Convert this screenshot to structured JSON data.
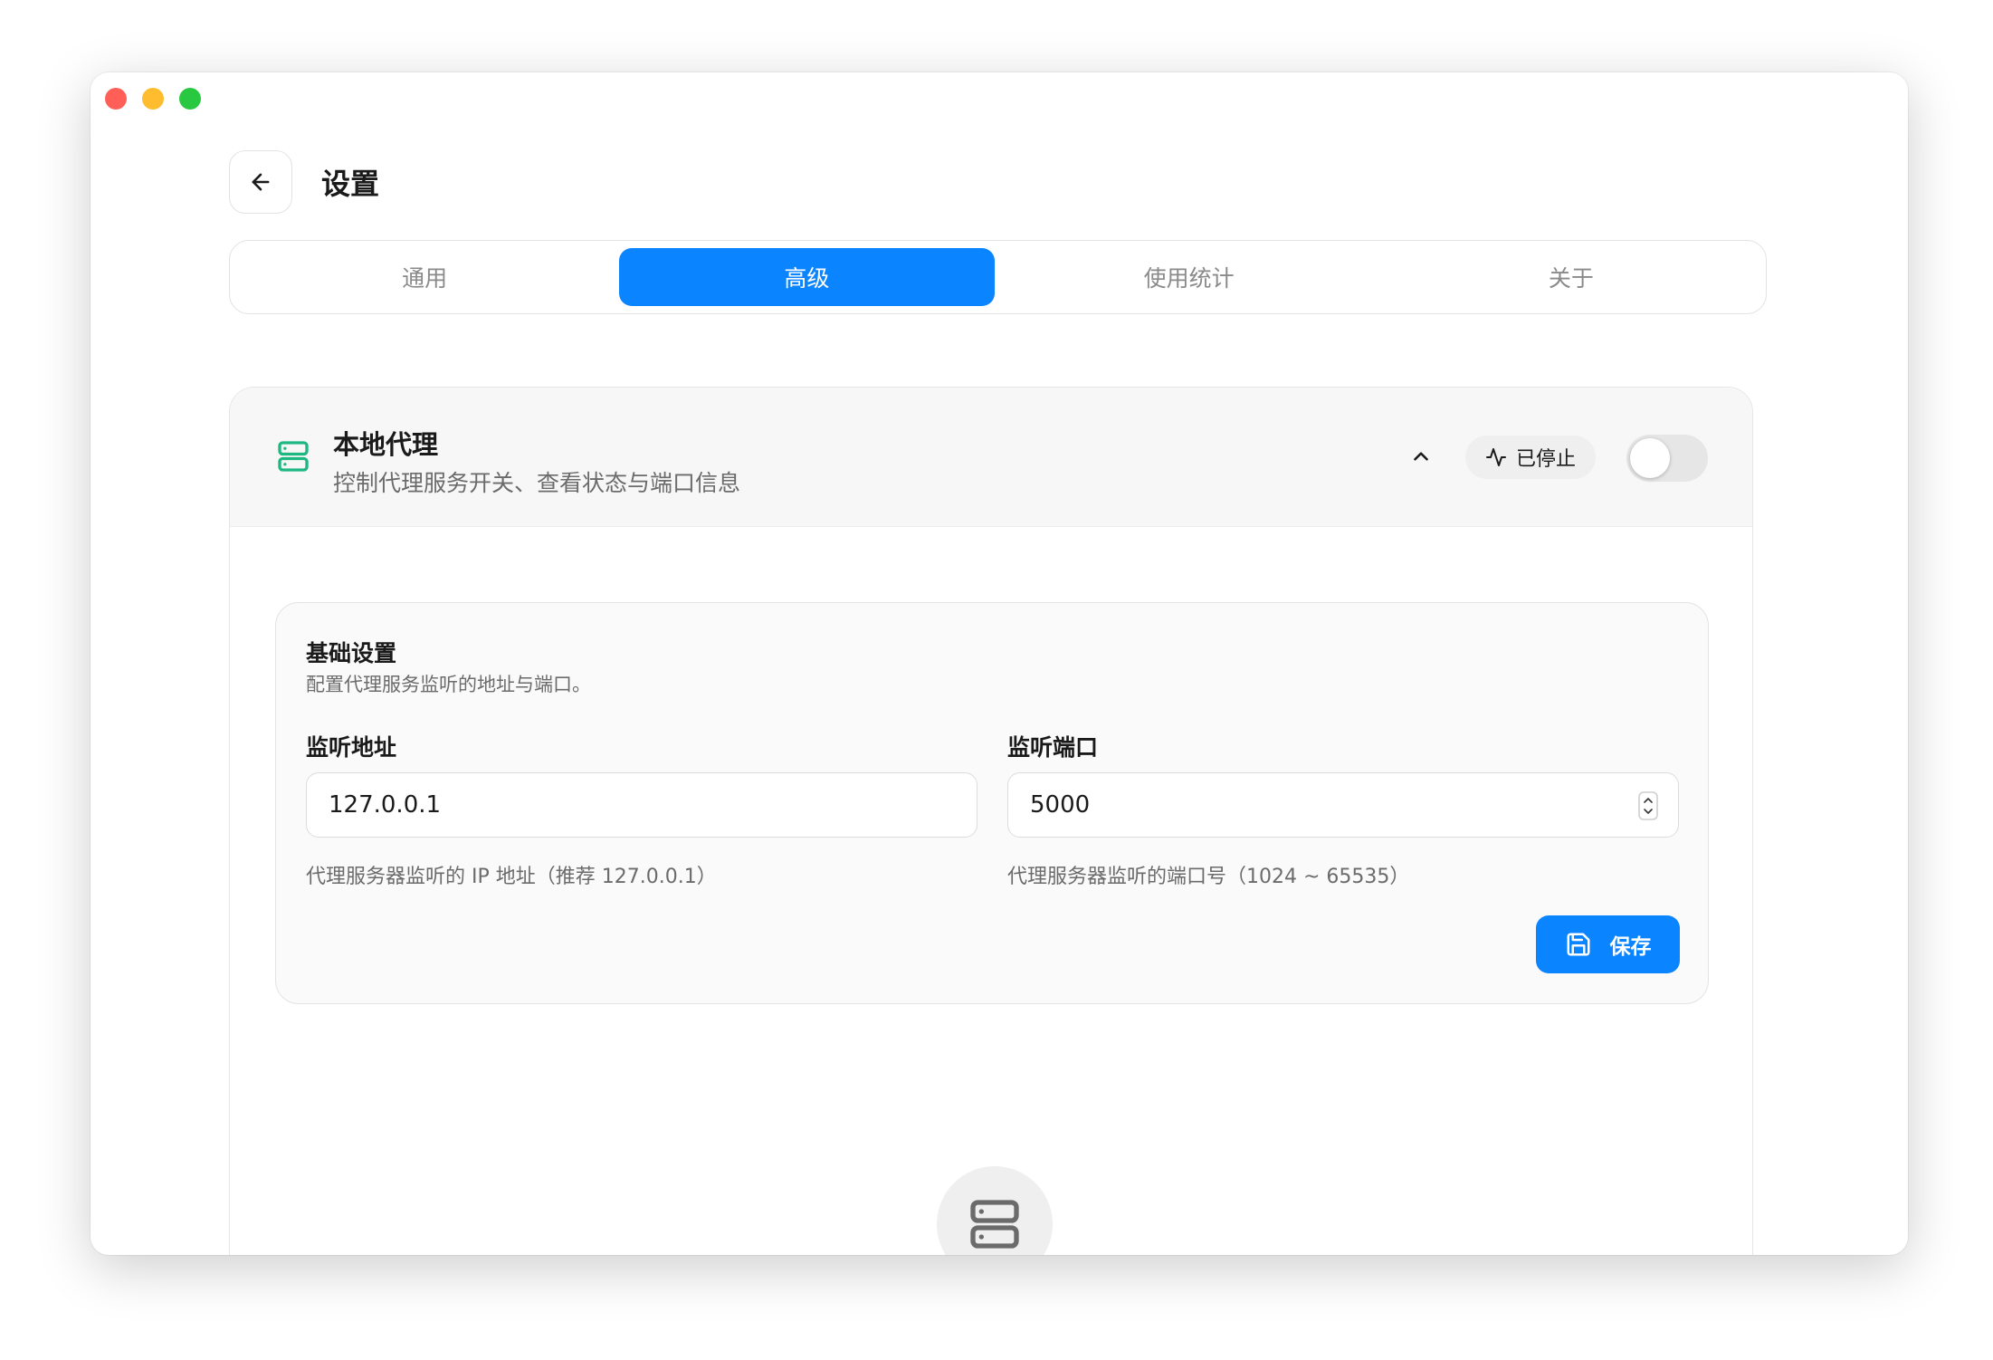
{
  "header": {
    "title": "设置"
  },
  "tabs": [
    {
      "label": "通用",
      "active": false
    },
    {
      "label": "高级",
      "active": true
    },
    {
      "label": "使用统计",
      "active": false
    },
    {
      "label": "关于",
      "active": false
    }
  ],
  "proxy": {
    "title": "本地代理",
    "description": "控制代理服务开关、查看状态与端口信息",
    "status": "已停止",
    "enabled": false
  },
  "basic": {
    "title": "基础设置",
    "description": "配置代理服务监听的地址与端口。",
    "address_label": "监听地址",
    "address_value": "127.0.0.1",
    "address_help": "代理服务器监听的 IP 地址（推荐 127.0.0.1）",
    "port_label": "监听端口",
    "port_value": "5000",
    "port_help": "代理服务器监听的端口号（1024 ~ 65535）",
    "save_label": "保存"
  },
  "colors": {
    "accent": "#0b84ff",
    "proxy_icon": "#1db882",
    "toggle_off": "#e6e6e6"
  },
  "icons": {
    "back": "arrow-left-icon",
    "proxy": "server-icon",
    "collapse": "chevron-up-icon",
    "status": "activity-icon",
    "save": "save-icon",
    "empty": "server-icon"
  }
}
